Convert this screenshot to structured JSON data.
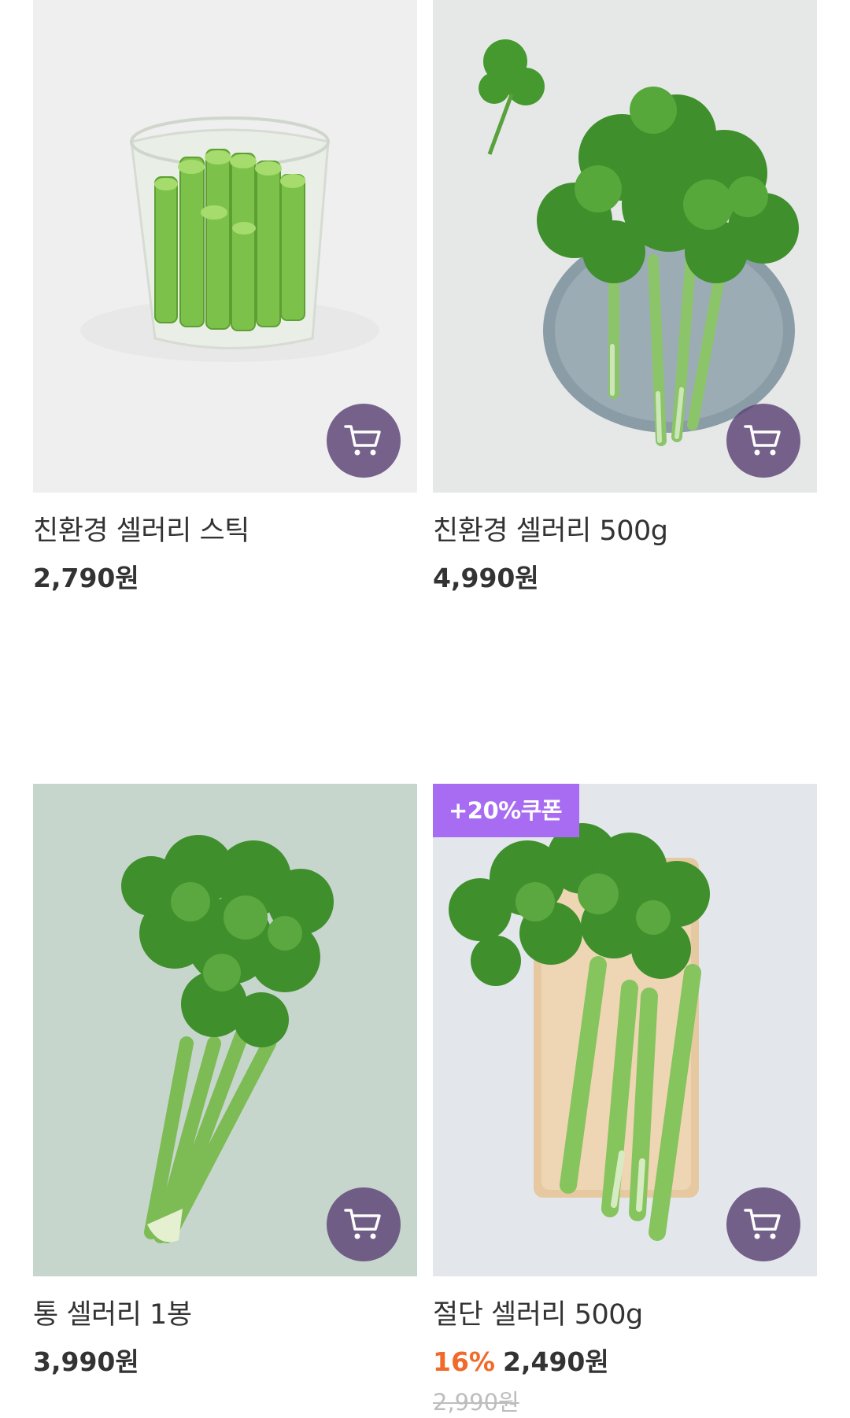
{
  "products": [
    {
      "name": "친환경 셀러리 스틱",
      "price": "2,790원",
      "cart_icon": "cart-icon",
      "image": "celery-sticks-cup"
    },
    {
      "name": "친환경 셀러리 500g",
      "price": "4,990원",
      "cart_icon": "cart-icon",
      "image": "celery-bunch-on-plate"
    },
    {
      "name": "통 셀러리 1봉",
      "price": "3,990원",
      "cart_icon": "cart-icon",
      "image": "whole-celery-bunch"
    },
    {
      "name": "절단 셀러리 500g",
      "coupon": "+20%쿠폰",
      "discount": "16%",
      "price": "2,490원",
      "original_price": "2,990원",
      "cart_icon": "cart-icon",
      "image": "cut-celery-on-board"
    }
  ],
  "colors": {
    "cart_button": "#5f4878",
    "coupon_badge": "#a86cf2",
    "discount": "#f06b2b",
    "text": "#333333",
    "original_price": "#bdbdbd"
  }
}
